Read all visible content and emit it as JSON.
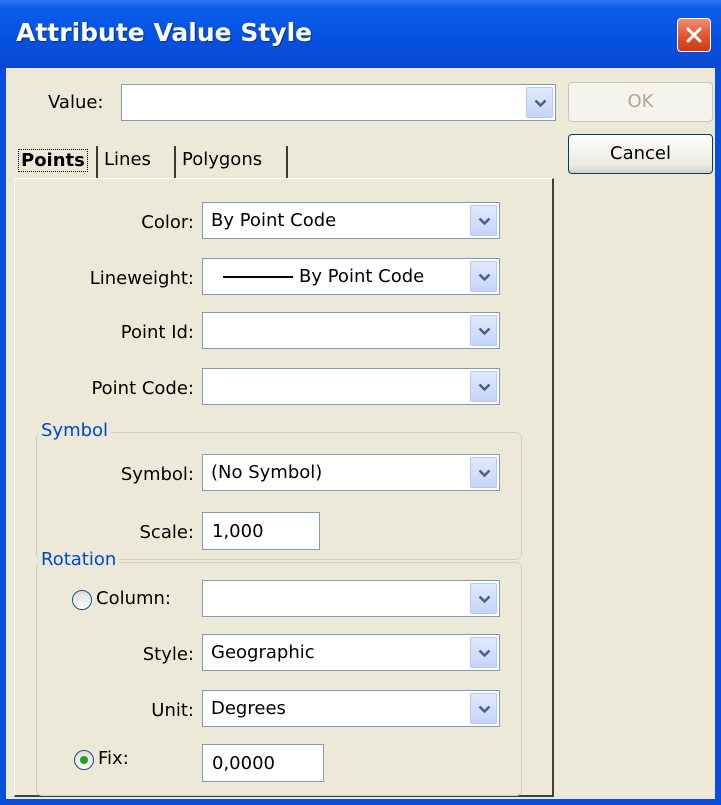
{
  "window": {
    "title": "Attribute Value Style"
  },
  "value_row": {
    "label": "Value:",
    "value": ""
  },
  "buttons": {
    "ok": "OK",
    "cancel": "Cancel"
  },
  "tabs": [
    {
      "label": "Points",
      "selected": true
    },
    {
      "label": "Lines",
      "selected": false
    },
    {
      "label": "Polygons",
      "selected": false
    }
  ],
  "points": {
    "color": {
      "label": "Color:",
      "value": "By Point Code"
    },
    "lineweight": {
      "label": "Lineweight:",
      "value": "By Point Code"
    },
    "point_id": {
      "label": "Point Id:",
      "value": ""
    },
    "point_code": {
      "label": "Point Code:",
      "value": ""
    }
  },
  "symbol_group": {
    "title": "Symbol",
    "symbol": {
      "label": "Symbol:",
      "value": "(No Symbol)"
    },
    "scale": {
      "label": "Scale:",
      "value": "1,000"
    }
  },
  "rotation_group": {
    "title": "Rotation",
    "column": {
      "label": "Column:",
      "value": "",
      "selected": false
    },
    "style": {
      "label": "Style:",
      "value": "Geographic"
    },
    "unit": {
      "label": "Unit:",
      "value": "Degrees"
    },
    "fix": {
      "label": "Fix:",
      "value": "0,0000",
      "selected": true
    }
  },
  "colors": {
    "title_bar": "#0a4ee0",
    "dialog_bg": "#ece9d8",
    "group_title": "#0046d5",
    "close_button": "#e2532b"
  },
  "icons": {
    "close": "close-icon",
    "dropdown": "chevron-down-icon"
  }
}
